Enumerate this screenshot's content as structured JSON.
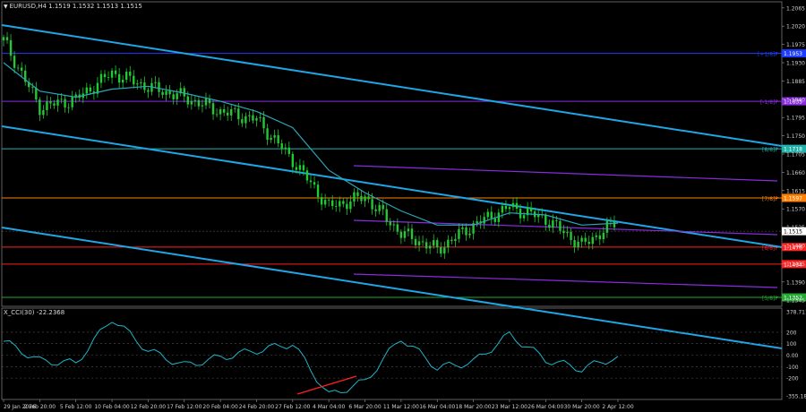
{
  "window": {
    "symbol": "EURUSD,H4",
    "ohlc": "1.1519 1.1532 1.1513 1.1515",
    "indicator": "X_CCI(30) -22.2368"
  },
  "colors": {
    "background": "#000000",
    "candles": "#22c933",
    "ma": "#29a8b8",
    "channel": "#1ea6e6",
    "murrey_violet": "#8a2be2",
    "murrey_red": "#ff2020",
    "murrey_orange": "#ff8000",
    "cci": "#1eb4c8",
    "divergence": "#ff2020"
  },
  "murrey_levels": [
    {
      "label": "[+1/8]P",
      "price": 1.1953,
      "price_label": "1.1953",
      "color": "#1e3cff"
    },
    {
      "label": "[-1/8]P",
      "price": 1.1835,
      "price_label": "1.1835",
      "color": "#8a2be2"
    },
    {
      "label": "[8/8]P",
      "price": 1.1718,
      "price_label": "1.1718",
      "color": "#20b2aa"
    },
    {
      "label": "[7/8]P",
      "price": 1.1597,
      "price_label": "1.1597",
      "color": "#ff8000"
    },
    {
      "label": "[6/8]P",
      "price": 1.1476,
      "price_label": "1.1476",
      "color": "#ff2020"
    },
    {
      "label": "",
      "price": 1.1434,
      "price_label": "1.1434",
      "color": "#ff2020"
    },
    {
      "label": "[5/8]P",
      "price": 1.1352,
      "price_label": "1.1352",
      "color": "#22aa33"
    }
  ],
  "price_axis": [
    "1.2065",
    "1.2020",
    "1.1975",
    "1.1930",
    "1.1885",
    "1.1840",
    "1.1795",
    "1.1750",
    "1.1705",
    "1.1660",
    "1.1615",
    "1.1570",
    "1.1525",
    "1.1480",
    "1.1435",
    "1.1390",
    "1.1345"
  ],
  "current_price_label": "1.1515",
  "cci_axis": [
    "378.7116",
    "200",
    "100",
    "0.00",
    "-100",
    "-200",
    "-355.189"
  ],
  "time_axis": [
    "29 Jan 2026",
    "2 Feb 20:00",
    "5 Feb 12:00",
    "10 Feb 04:00",
    "12 Feb 20:00",
    "17 Feb 12:00",
    "20 Feb 04:00",
    "24 Feb 20:00",
    "27 Feb 12:00",
    "4 Mar 04:00",
    "6 Mar 20:00",
    "11 Mar 12:00",
    "16 Mar 04:00",
    "18 Mar 20:00",
    "23 Mar 12:00",
    "26 Mar 04:00",
    "30 Mar 20:00",
    "2 Apr 12:00"
  ],
  "chart_data": {
    "type": "line",
    "symbol": "EURUSD",
    "timeframe": "H4",
    "x": [
      "29 Jan 2026",
      "2 Feb 20:00",
      "5 Feb 12:00",
      "10 Feb 04:00",
      "12 Feb 20:00",
      "17 Feb 12:00",
      "20 Feb 04:00",
      "24 Feb 20:00",
      "27 Feb 12:00",
      "4 Mar 04:00",
      "6 Mar 20:00",
      "11 Mar 12:00",
      "16 Mar 04:00",
      "18 Mar 20:00",
      "23 Mar 12:00",
      "26 Mar 04:00",
      "30 Mar 20:00",
      "2 Apr 12:00"
    ],
    "close": [
      1.1985,
      1.182,
      1.184,
      1.1905,
      1.187,
      1.1845,
      1.181,
      1.179,
      1.169,
      1.1575,
      1.16,
      1.151,
      1.147,
      1.153,
      1.1575,
      1.1545,
      1.148,
      1.154
    ],
    "ma": [
      1.193,
      1.186,
      1.1845,
      1.1865,
      1.1872,
      1.1855,
      1.1835,
      1.181,
      1.177,
      1.1665,
      1.161,
      1.1565,
      1.153,
      1.153,
      1.156,
      1.1555,
      1.153,
      1.1535
    ],
    "last_close": 1.1515,
    "ylim": [
      1.133,
      1.208
    ],
    "cci": [
      120,
      -50,
      -70,
      320,
      40,
      -90,
      -20,
      40,
      100,
      -350,
      -230,
      150,
      -110,
      -60,
      180,
      -40,
      -120,
      -10
    ],
    "cci_ylim": [
      -355.189,
      378.7116
    ]
  }
}
